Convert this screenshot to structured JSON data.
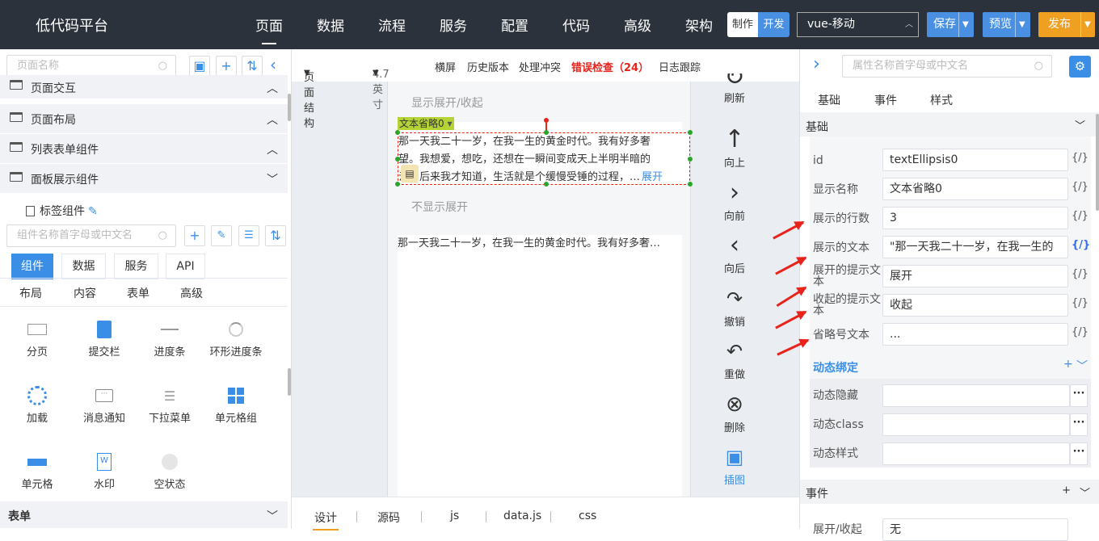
{
  "header": {
    "app_title": "低代码平台",
    "nav": [
      "页面",
      "数据",
      "流程",
      "服务",
      "配置",
      "代码",
      "高级",
      "架构"
    ],
    "mode_toggle": [
      "制作",
      "开发"
    ],
    "env_select": "vue-移动",
    "save": "保存",
    "preview": "预览",
    "publish": "发布"
  },
  "left": {
    "page_search_placeholder": "页面名称",
    "groups": [
      "页面交互",
      "页面布局",
      "列表表单组件",
      "面板展示组件"
    ],
    "tag_component": "标签组件",
    "comp_search_placeholder": "组件名称首字母或中文名",
    "tabs": [
      "组件",
      "数据",
      "服务",
      "API"
    ],
    "subtabs": [
      "布局",
      "内容",
      "表单",
      "高级"
    ],
    "components": [
      "分页",
      "提交栏",
      "进度条",
      "环形进度条",
      "加载",
      "消息通知",
      "下拉菜单",
      "单元格组",
      "单元格",
      "水印",
      "空状态"
    ],
    "bottom_group": "表单"
  },
  "center": {
    "toolbar": {
      "page_structure": "页面结构",
      "size": "4.7 英寸",
      "landscape": "横屏",
      "history": "历史版本",
      "conflict": "处理冲突",
      "error_check": "错误检查（24）",
      "log": "日志跟踪"
    },
    "canvas": {
      "section1_title": "显示展开/收起",
      "component_tag": "文本省略0",
      "text_line1": "那一天我二十一岁，在我一生的黄金时代。我有好多奢",
      "text_line2": "望。我想爱，想吃，还想在一瞬间变成天上半明半暗的",
      "text_line3": "云，后来我才知道，生活就是个缓慢受锤的过程，…",
      "expand_link": "展开",
      "section2_title": "不显示展开",
      "text_single": "那一天我二十一岁，在我一生的黄金时代。我有好多奢…"
    },
    "side_tools": [
      "刷新",
      "向上",
      "向前",
      "向后",
      "撤销",
      "重做",
      "删除",
      "插图"
    ],
    "bottom_tabs": [
      "设计",
      "源码",
      "js",
      "data.js",
      "css"
    ]
  },
  "right": {
    "search_placeholder": "属性名称首字母或中文名",
    "tabs": [
      "基础",
      "事件",
      "样式"
    ],
    "section_basic": "基础",
    "props": [
      {
        "label": "id",
        "value": "textEllipsis0"
      },
      {
        "label": "显示名称",
        "value": "文本省略0"
      },
      {
        "label": "展示的行数",
        "value": "3"
      },
      {
        "label": "展示的文本",
        "value": "\"那一天我二十一岁，在我一生的"
      },
      {
        "label": "展开的提示文本",
        "value": "展开"
      },
      {
        "label": "收起的提示文本",
        "value": "收起"
      },
      {
        "label": "省略号文本",
        "value": "..."
      }
    ],
    "expr_icon": "{/}",
    "dynamic_title": "动态绑定",
    "dynamic_props": [
      "动态隐藏",
      "动态class",
      "动态样式"
    ],
    "section_event": "事件",
    "event_row_label": "展开/收起",
    "event_row_value": "无"
  },
  "colors": {
    "topbar": "#2b323b",
    "accent": "#3a8ee6",
    "save_btn": "#4a90e2",
    "publish_btn": "#f0a020",
    "error": "#e8231b",
    "tag": "#b5d334"
  }
}
